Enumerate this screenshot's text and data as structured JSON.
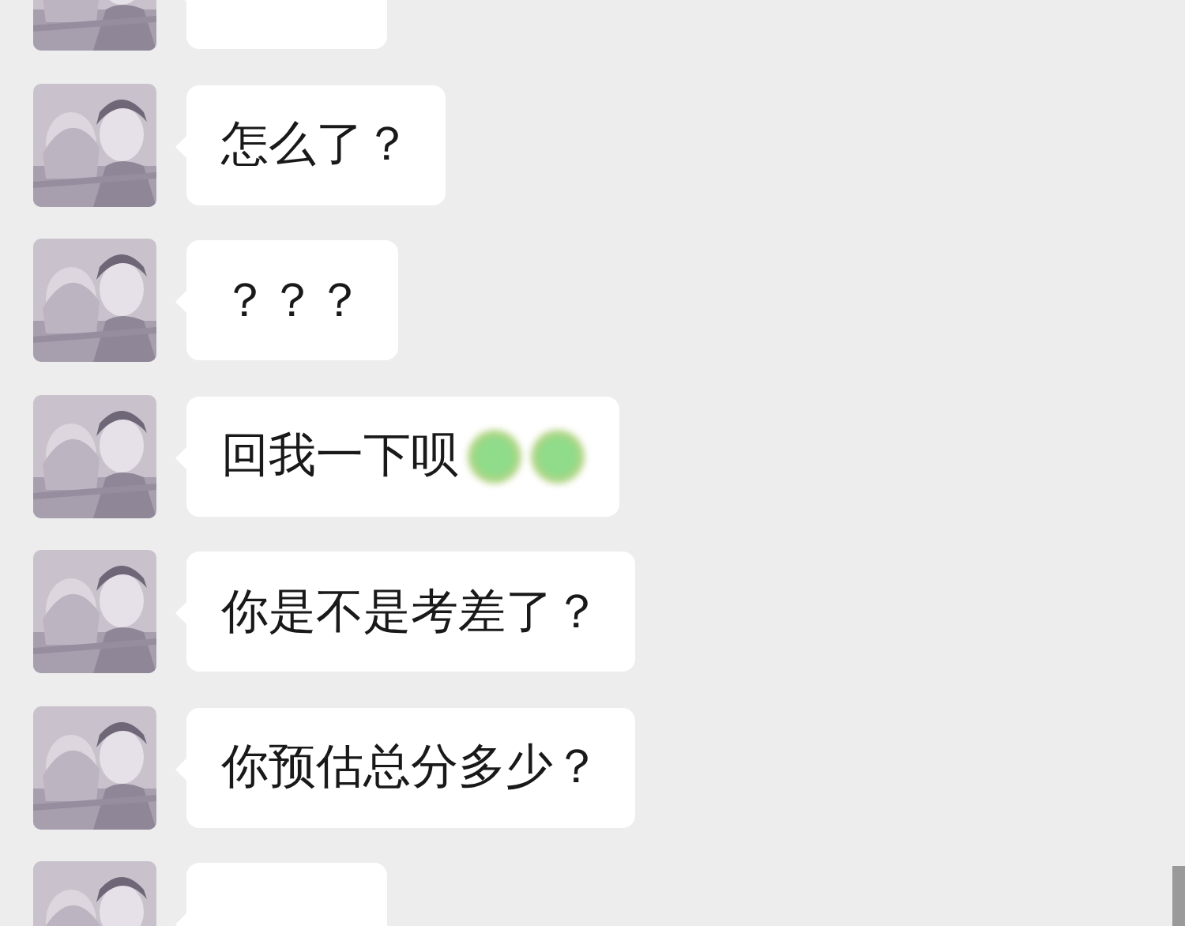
{
  "messages": [
    {
      "kind": "cut"
    },
    {
      "kind": "text",
      "text": "怎么了？"
    },
    {
      "kind": "text",
      "text": "？？？"
    },
    {
      "kind": "text",
      "text": "回我一下呗",
      "emojis": [
        {
          "kind": "blurred"
        },
        {
          "kind": "blurred"
        }
      ]
    },
    {
      "kind": "text",
      "text": "你是不是考差了？"
    },
    {
      "kind": "text",
      "text": "你预估总分多少？"
    },
    {
      "kind": "cut"
    }
  ]
}
